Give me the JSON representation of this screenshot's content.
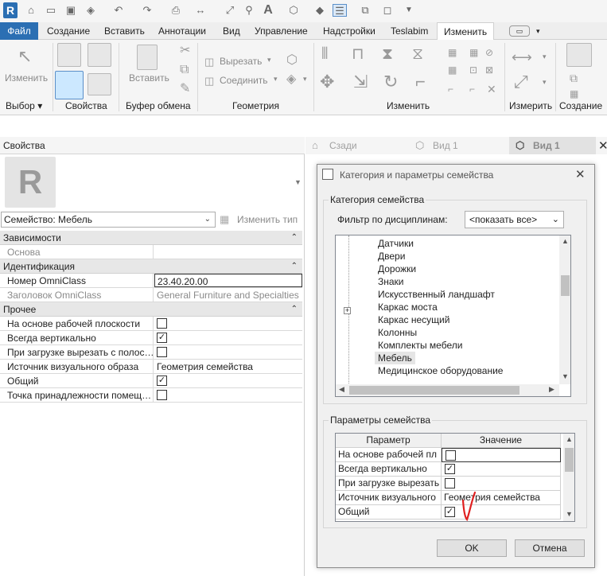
{
  "ribbon_tabs": [
    "Файл",
    "Создание",
    "Вставить",
    "Аннотации",
    "Вид",
    "Управление",
    "Надстройки",
    "Teslabim",
    "Изменить"
  ],
  "ribbon": {
    "modify_label": "Изменить",
    "cut_label": "Вырезать",
    "join_label": "Соединить",
    "paste_label": "Вставить",
    "groups": [
      "Выбор",
      "Свойства",
      "Буфер обмена",
      "Геометрия",
      "Изменить",
      "Измерить",
      "Создание"
    ]
  },
  "properties": {
    "title": "Свойства",
    "family_selector": "Семейство: Мебель",
    "edit_type_label": "Изменить тип",
    "groups": {
      "constraints": "Зависимости",
      "identity": "Идентификация",
      "other": "Прочее"
    },
    "rows": {
      "base_label": "Основа",
      "omniclass_number_label": "Номер OmniClass",
      "omniclass_number_value": "23.40.20.00",
      "omniclass_title_label": "Заголовок OmniClass",
      "omniclass_title_value": "General Furniture and Specialties",
      "workplane_label": "На основе рабочей плоскости",
      "always_vertical_label": "Всегда вертикально",
      "cut_voids_label": "При загрузке вырезать с полос…",
      "visual_source_label": "Источник визуального образа",
      "visual_source_value": "Геометрия семейства",
      "shared_label": "Общий",
      "room_point_label": "Точка принадлежности помещ…"
    }
  },
  "view_tabs": [
    "Сзади",
    "Вид 1",
    "Вид 1"
  ],
  "dialog": {
    "title": "Категория и параметры семейства",
    "category_legend": "Категория семейства",
    "filter_label": "Фильтр по дисциплинам:",
    "filter_value": "<показать все>",
    "categories": [
      "Датчики",
      "Двери",
      "Дорожки",
      "Знаки",
      "Искусственный ландшафт",
      "Каркас моста",
      "Каркас несущий",
      "Колонны",
      "Комплекты мебели",
      "Мебель",
      "Медицинское оборудование"
    ],
    "selected_category": "Мебель",
    "params_legend": "Параметры семейства",
    "table_headers": [
      "Параметр",
      "Значение"
    ],
    "params": [
      {
        "name": "На основе рабочей пл",
        "checked": false
      },
      {
        "name": "Всегда вертикально",
        "checked": true
      },
      {
        "name": "При загрузке вырезать",
        "checked": false
      },
      {
        "name": "Источник визуального",
        "value": "Геометрия семейства"
      },
      {
        "name": "Общий",
        "checked": true
      }
    ],
    "ok_label": "OK",
    "cancel_label": "Отмена"
  },
  "accent_colors": {
    "file_tab": "#2b6fb3",
    "selection": "#cce8ff",
    "annotation": "#e02020"
  }
}
